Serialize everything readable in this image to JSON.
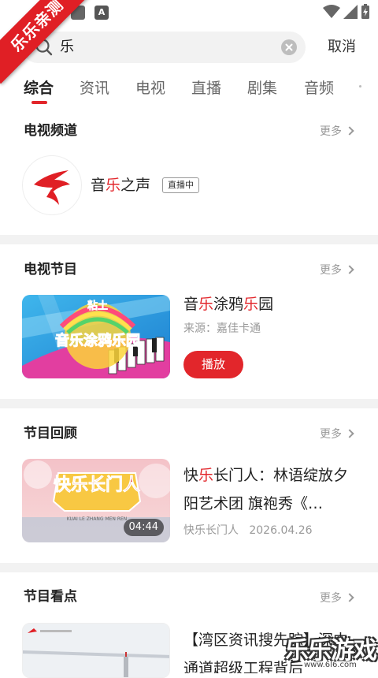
{
  "branding": {
    "ribbon_text": "乐乐亲测",
    "watermark_text": "乐乐游戏",
    "watermark_url": "www.6l6.com"
  },
  "status_bar": {
    "icons": [
      "app-icon",
      "a-notification-icon",
      "wifi-icon",
      "signal-icon",
      "battery-icon"
    ]
  },
  "search": {
    "value": "乐",
    "cancel_label": "取消"
  },
  "tabs": [
    "综合",
    "资讯",
    "电视",
    "直播",
    "剧集",
    "音频"
  ],
  "active_tab": "综合",
  "accent_color": "#e2262b",
  "sections": {
    "tv_channels": {
      "title": "电视频道",
      "more": "更多",
      "channel": {
        "name_pre": "音",
        "name_hl": "乐",
        "name_post": "之声",
        "badge": "直播中"
      }
    },
    "tv_programs": {
      "title": "电视节目",
      "more": "更多",
      "item": {
        "title_pre": "音",
        "title_hl1": "乐",
        "title_mid": "涂鸦",
        "title_hl2": "乐",
        "title_post": "园",
        "source": "来源：嘉佳卡通",
        "play_label": "播放",
        "thumb_text_top": "粘土",
        "thumb_text_main": "音乐涂鸦乐园"
      }
    },
    "program_review": {
      "title": "节目回顾",
      "more": "更多",
      "item": {
        "title_pre": "快",
        "title_hl": "乐",
        "title_post": "长门人：林语绽放夕阳艺术团 旗袍秀《…",
        "channel": "快乐长门人",
        "date": "2026.04.26",
        "duration": "04:44",
        "thumb_text": "快乐长门人",
        "thumb_sub": "KUAI LE ZHANG MEN REN"
      }
    },
    "highlights": {
      "title": "节目看点",
      "more": "更多",
      "item": {
        "title": "【湾区资讯搜先踪】深中通道超级工程背后"
      }
    }
  }
}
